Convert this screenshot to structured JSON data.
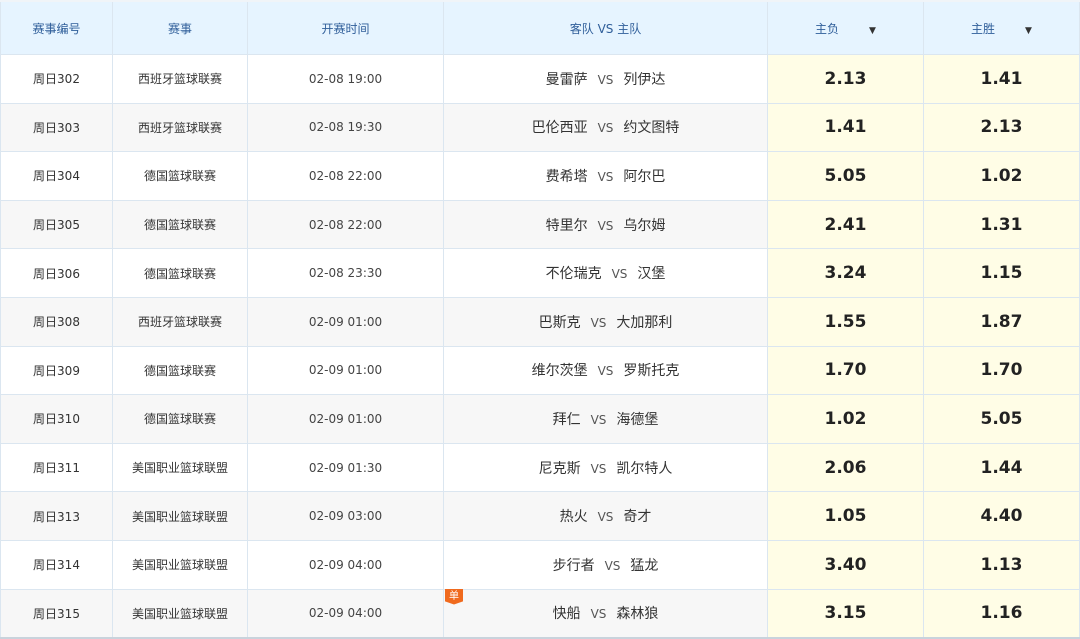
{
  "headers": {
    "id": "赛事编号",
    "league": "赛事",
    "time": "开赛时间",
    "match": "客队 VS 主队",
    "lose": "主负",
    "win": "主胜",
    "sort_icon": "caret-down-icon"
  },
  "vs": "VS",
  "colors": {
    "header_bg": "#e6f4ff",
    "odds_bg": "#fffde6",
    "tag": "#f06a1e"
  },
  "rows": [
    {
      "id": "周日302",
      "league": "西班牙篮球联赛",
      "time": "02-08 19:00",
      "away": "曼雷萨",
      "home": "列伊达",
      "lose": "2.13",
      "win": "1.41"
    },
    {
      "id": "周日303",
      "league": "西班牙篮球联赛",
      "time": "02-08 19:30",
      "away": "巴伦西亚",
      "home": "约文图特",
      "lose": "1.41",
      "win": "2.13"
    },
    {
      "id": "周日304",
      "league": "德国篮球联赛",
      "time": "02-08 22:00",
      "away": "费希塔",
      "home": "阿尔巴",
      "lose": "5.05",
      "win": "1.02"
    },
    {
      "id": "周日305",
      "league": "德国篮球联赛",
      "time": "02-08 22:00",
      "away": "特里尔",
      "home": "乌尔姆",
      "lose": "2.41",
      "win": "1.31"
    },
    {
      "id": "周日306",
      "league": "德国篮球联赛",
      "time": "02-08 23:30",
      "away": "不伦瑞克",
      "home": "汉堡",
      "lose": "3.24",
      "win": "1.15"
    },
    {
      "id": "周日308",
      "league": "西班牙篮球联赛",
      "time": "02-09 01:00",
      "away": "巴斯克",
      "home": "大加那利",
      "lose": "1.55",
      "win": "1.87"
    },
    {
      "id": "周日309",
      "league": "德国篮球联赛",
      "time": "02-09 01:00",
      "away": "维尔茨堡",
      "home": "罗斯托克",
      "lose": "1.70",
      "win": "1.70"
    },
    {
      "id": "周日310",
      "league": "德国篮球联赛",
      "time": "02-09 01:00",
      "away": "拜仁",
      "home": "海德堡",
      "lose": "1.02",
      "win": "5.05"
    },
    {
      "id": "周日311",
      "league": "美国职业篮球联盟",
      "time": "02-09 01:30",
      "away": "尼克斯",
      "home": "凯尔特人",
      "lose": "2.06",
      "win": "1.44"
    },
    {
      "id": "周日313",
      "league": "美国职业篮球联盟",
      "time": "02-09 03:00",
      "away": "热火",
      "home": "奇才",
      "lose": "1.05",
      "win": "4.40"
    },
    {
      "id": "周日314",
      "league": "美国职业篮球联盟",
      "time": "02-09 04:00",
      "away": "步行者",
      "home": "猛龙",
      "lose": "3.40",
      "win": "1.13"
    },
    {
      "id": "周日315",
      "league": "美国职业篮球联盟",
      "time": "02-09 04:00",
      "away": "快船",
      "home": "森林狼",
      "lose": "3.15",
      "win": "1.16",
      "tag": "单"
    }
  ]
}
